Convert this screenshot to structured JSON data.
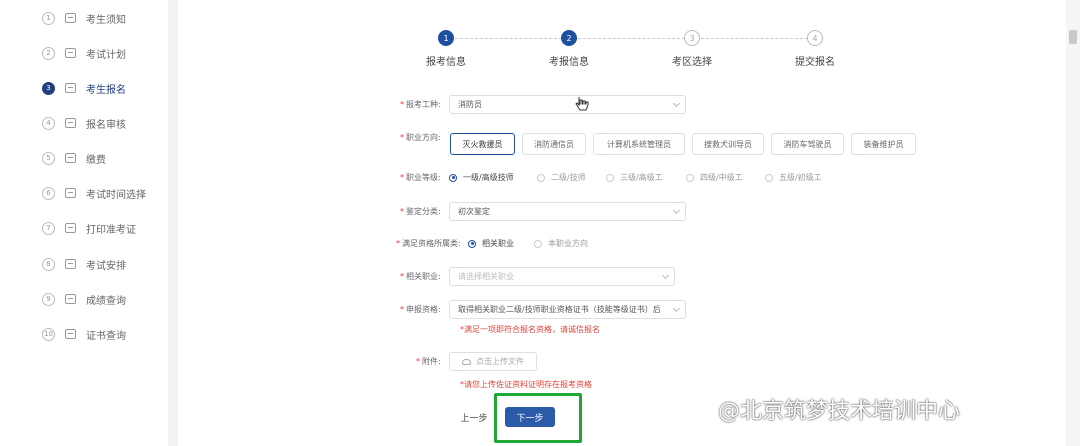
{
  "sidebar": {
    "items": [
      {
        "num": "1",
        "label": "考生须知"
      },
      {
        "num": "2",
        "label": "考试计划"
      },
      {
        "num": "3",
        "label": "考生报名",
        "active": true
      },
      {
        "num": "4",
        "label": "报名审核"
      },
      {
        "num": "5",
        "label": "缴费"
      },
      {
        "num": "6",
        "label": "考试时间选择"
      },
      {
        "num": "7",
        "label": "打印准考证"
      },
      {
        "num": "8",
        "label": "考试安排"
      },
      {
        "num": "9",
        "label": "成绩查询"
      },
      {
        "num": "10",
        "label": "证书查询"
      }
    ]
  },
  "steps": [
    {
      "num": "1",
      "label": "报考信息",
      "status": "done"
    },
    {
      "num": "2",
      "label": "考报信息",
      "status": "done"
    },
    {
      "num": "3",
      "label": "考区选择",
      "status": "todo"
    },
    {
      "num": "4",
      "label": "提交报名",
      "status": "todo"
    }
  ],
  "form": {
    "job_type": {
      "label": "报考工种:",
      "value": "消防员"
    },
    "direction": {
      "label": "职业方向:",
      "options": [
        "灭火救援员",
        "消防通信员",
        "计算机系统管理员",
        "搜救犬训导员",
        "消防车驾驶员",
        "装备维护员"
      ],
      "selected": "灭火救援员"
    },
    "level": {
      "label": "职业等级:",
      "options": [
        "一级/高级技师",
        "二级/技师",
        "三级/高级工",
        "四级/中级工",
        "五级/初级工"
      ],
      "selected": "一级/高级技师"
    },
    "appraisal": {
      "label": "鉴定分类:",
      "value": "初次鉴定"
    },
    "qualification_belongs": {
      "label": "满足资格所属类:",
      "options": [
        "相关职业",
        "本职业方向"
      ],
      "selected": "相关职业"
    },
    "related_job": {
      "label": "相关职业:",
      "placeholder": "请选择相关职业"
    },
    "apply_qualification": {
      "label": "申报资格:",
      "value": "取得相关职业二级/技师职业资格证书（技能等级证书）后",
      "hint": "*满足一项即符合报名资格，请诚信报名"
    },
    "attachment": {
      "label": "附件:",
      "upload_label": "点击上传文件",
      "hint": "*请您上传佐证资料证明存在报考资格"
    }
  },
  "buttons": {
    "prev": "上一步",
    "next": "下一步"
  },
  "watermark": "@北京筑梦技术培训中心",
  "colors": {
    "primary": "#1f4f9f",
    "highlight": "#1fa838",
    "required": "#e33333"
  }
}
